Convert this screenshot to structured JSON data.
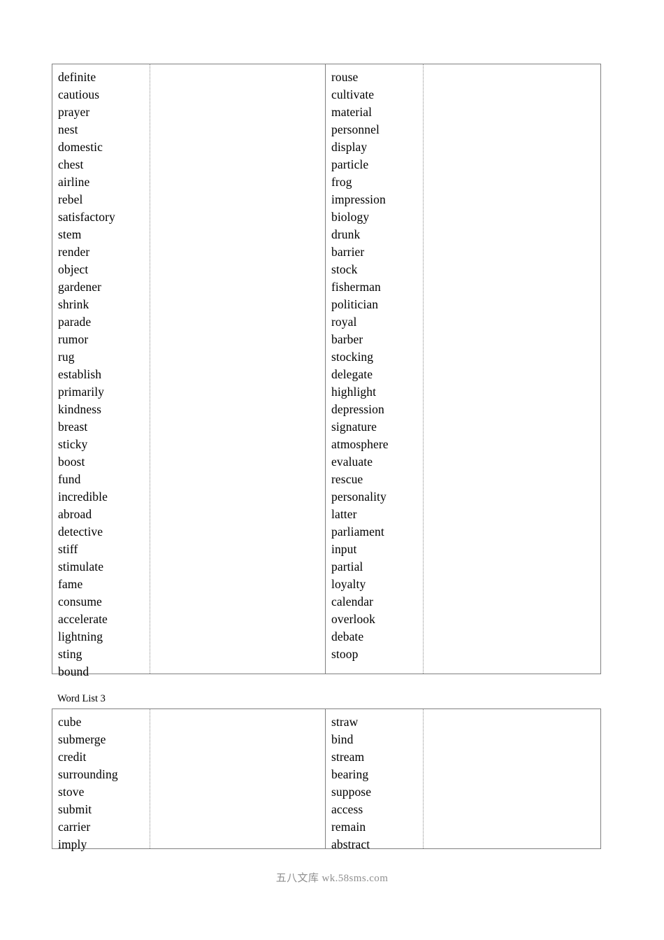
{
  "document": {
    "section_caption": "Word List 3",
    "footer_watermark": "五八文库 wk.58sms.com"
  },
  "tables": [
    {
      "id": "word-table-1",
      "columns": [
        {
          "type": "words",
          "words": [
            "definite",
            "cautious",
            "prayer",
            "nest",
            "domestic",
            "chest",
            "airline",
            "rebel",
            "satisfactory",
            "stem",
            "render",
            "object",
            "gardener",
            "shrink",
            "parade",
            "rumor",
            "rug",
            "establish",
            "primarily",
            "kindness",
            "breast",
            "sticky",
            "boost",
            "fund",
            "incredible",
            "abroad",
            "detective",
            "stiff",
            "stimulate",
            "fame",
            "consume",
            "accelerate",
            "lightning",
            "sting",
            "bound"
          ]
        },
        {
          "type": "blank",
          "words": []
        },
        {
          "type": "words",
          "words": [
            "rouse",
            "cultivate",
            "material",
            "personnel",
            "display",
            "particle",
            "frog",
            "impression",
            "biology",
            "drunk",
            "barrier",
            "stock",
            "fisherman",
            "politician",
            "royal",
            "barber",
            "stocking",
            "delegate",
            "highlight",
            "depression",
            "signature",
            "atmosphere",
            "evaluate",
            "rescue",
            "personality",
            "latter",
            "parliament",
            "input",
            "partial",
            "loyalty",
            "calendar",
            "overlook",
            "debate",
            "stoop"
          ]
        },
        {
          "type": "blank",
          "words": []
        }
      ]
    },
    {
      "id": "word-table-2",
      "columns": [
        {
          "type": "words",
          "words": [
            "cube",
            "submerge",
            "credit",
            "surrounding",
            "stove",
            "submit",
            "carrier",
            "imply"
          ]
        },
        {
          "type": "blank",
          "words": []
        },
        {
          "type": "words",
          "words": [
            "straw",
            "bind",
            "stream",
            "bearing",
            "suppose",
            "access",
            "remain",
            "abstract"
          ]
        },
        {
          "type": "blank",
          "words": []
        }
      ]
    }
  ]
}
